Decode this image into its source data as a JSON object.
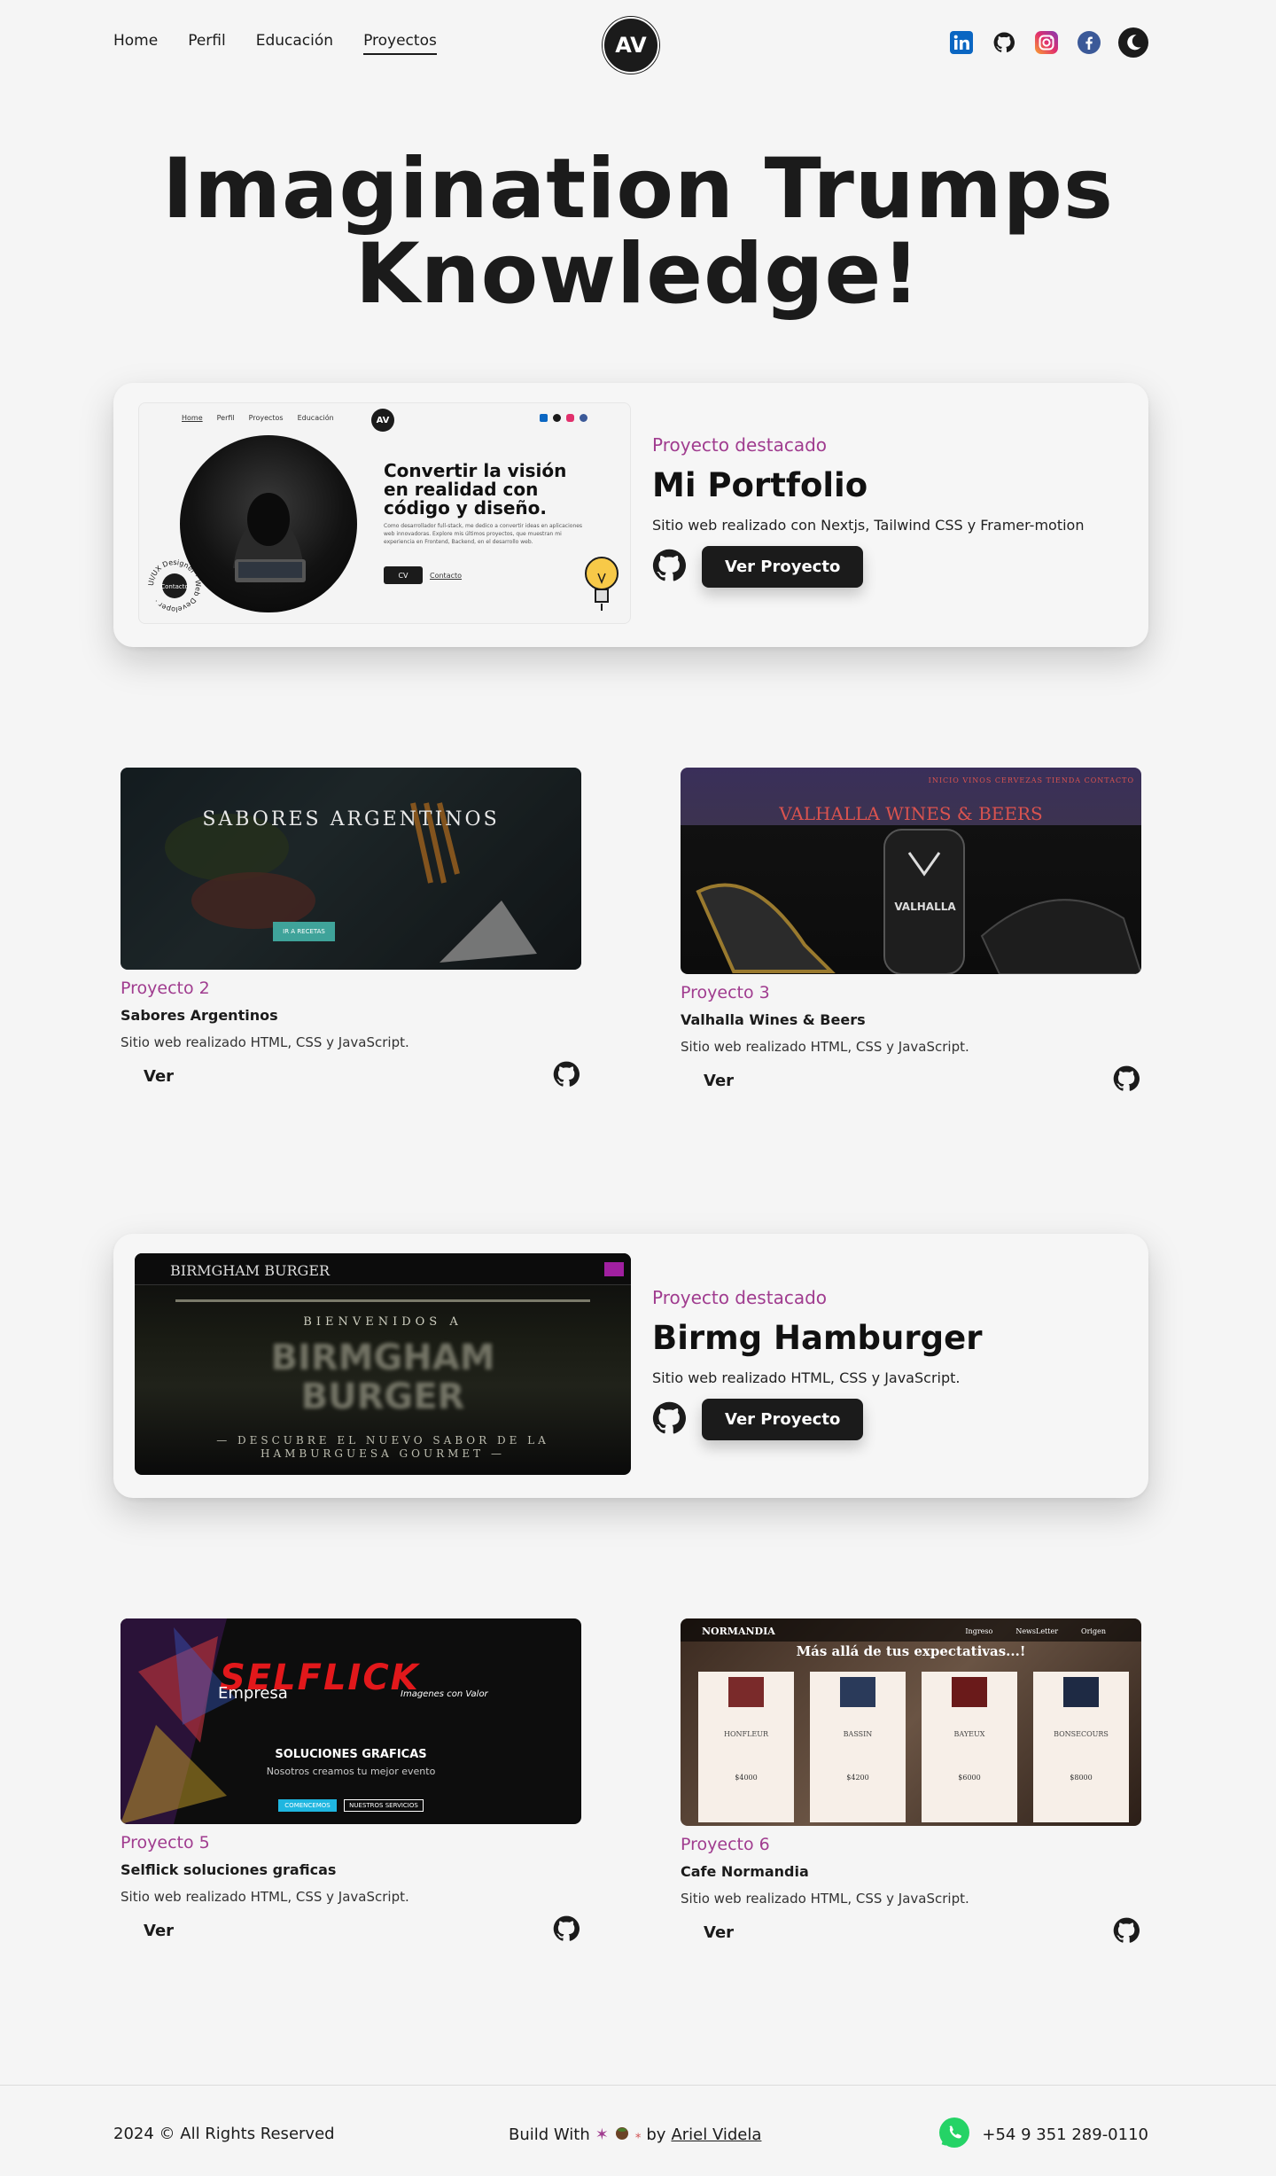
{
  "nav": {
    "links": [
      "Home",
      "Perfil",
      "Educación",
      "Proyectos"
    ],
    "logo": "AV",
    "socials": [
      "linkedin-icon",
      "github-icon",
      "instagram-icon",
      "facebook-icon"
    ],
    "theme_icon": "moon-icon"
  },
  "hero": {
    "line1": "Imagination Trumps",
    "line2": "Knowledge!"
  },
  "featured": [
    {
      "kind": "Proyecto destacado",
      "title": "Mi Portfolio",
      "desc": "Sitio web realizado con Nextjs, Tailwind CSS y Framer-motion",
      "button": "Ver Proyecto",
      "preview": {
        "nav": [
          "Home",
          "Perfil",
          "Proyectos",
          "Educación"
        ],
        "logo": "AV",
        "headline": "Convertir la visión en realidad con código y diseño.",
        "body": "Como desarrollador full-stack, me dedico a convertir ideas en aplicaciones web innovadoras. Explore mis últimos proyectos, que muestran mi experiencia en Frontend, Backend, en el desarrollo web.",
        "cv": "CV",
        "contact": "Contacto",
        "badge_ring": "UI/UX Designer · Web Developer ·",
        "badge_center": "Contacto"
      }
    },
    {
      "kind": "Proyecto destacado",
      "title": "Birmg Hamburger",
      "desc": "Sitio web realizado HTML, CSS y JavaScript.",
      "button": "Ver Proyecto",
      "preview": {
        "brand": "BIRMGHAM BURGER",
        "welcome": "BIENVENIDOS A",
        "big1": "BIRMGHAM",
        "big2": "BURGER",
        "tag1": "— DESCUBRE EL NUEVO SABOR DE LA",
        "tag2": "HAMBURGUESA GOURMET —"
      }
    }
  ],
  "projects": [
    {
      "kind": "Proyecto 2",
      "title": "Sabores Argentinos",
      "desc": "Sitio web realizado HTML, CSS y JavaScript.",
      "button": "Ver",
      "preview": {
        "title": "SABORES ARGENTINOS",
        "cta": "IR A RECETAS"
      }
    },
    {
      "kind": "Proyecto 3",
      "title": "Valhalla Wines & Beers",
      "desc": "Sitio web realizado HTML, CSS y JavaScript.",
      "button": "Ver",
      "preview": {
        "title": "VALHALLA WINES & BEERS",
        "nav": "INICIO  VINOS  CERVEZAS  TIENDA  CONTACTO",
        "label": "VALHALLA"
      }
    },
    {
      "kind": "Proyecto 5",
      "title": "Selflick soluciones graficas",
      "desc": "Sitio web realizado HTML, CSS y JavaScript.",
      "button": "Ver",
      "preview": {
        "logo": "SELFLICK",
        "sub1": "Empresa",
        "sub2": "Imagenes con Valor",
        "heading": "SOLUCIONES GRAFICAS",
        "tagline": "Nosotros creamos tu mejor evento",
        "btn1": "COMENCEMOS",
        "btn2": "NUESTROS SERVICIOS"
      }
    },
    {
      "kind": "Proyecto 6",
      "title": "Cafe Normandia",
      "desc": "Sitio web realizado HTML, CSS y JavaScript.",
      "button": "Ver",
      "preview": {
        "brand": "NORMANDIA",
        "heading": "Más allá de tus expectativas...!",
        "menu": [
          "Ingreso",
          "NewsLetter",
          "Origen"
        ],
        "products": [
          "HONFLEUR",
          "BASSIN",
          "BAYEUX",
          "BONSECOURS"
        ],
        "prices": [
          "$4000",
          "$4200",
          "$6000",
          "$8000"
        ]
      }
    }
  ],
  "footer": {
    "copyright": "2024 © All Rights Reserved",
    "build": "Build With",
    "by": "by",
    "author": "Ariel Videla",
    "phone": "+54 9 351 289-0110"
  },
  "colors": {
    "accent": "#a03c8f",
    "dark": "#1b1b1b",
    "background": "#f5f5f5",
    "whatsapp": "#25d366"
  }
}
